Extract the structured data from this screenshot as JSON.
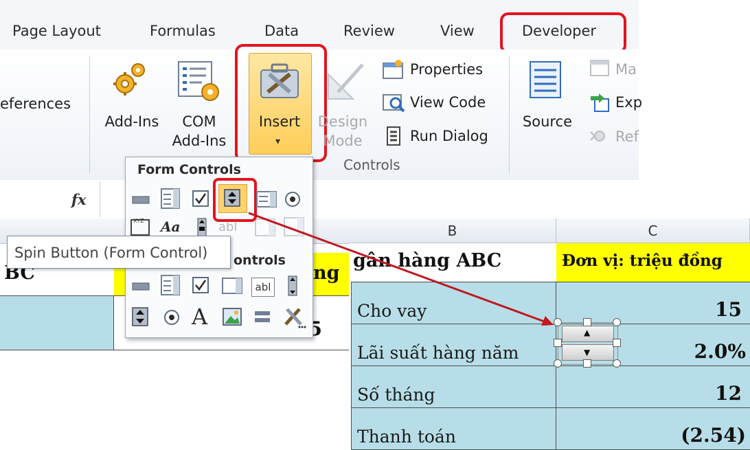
{
  "tabs": [
    {
      "label": "Page Layout"
    },
    {
      "label": "Formulas"
    },
    {
      "label": "Data"
    },
    {
      "label": "Review"
    },
    {
      "label": "View"
    },
    {
      "label": "Developer"
    }
  ],
  "ribbon": {
    "references_partial": "eferences",
    "addins_label": "Add-Ins",
    "com_line1": "COM",
    "com_line2": "Add-Ins",
    "insert_label": "Insert",
    "design_line1": "Design",
    "design_line2": "Mode",
    "properties_label": "Properties",
    "view_code_label": "View Code",
    "run_dialog_label": "Run Dialog",
    "controls_group_label": "Controls",
    "source_label": "Source",
    "map_partial": "Ma",
    "exp_partial": "Exp",
    "ref_partial": "Ref"
  },
  "formula_bar": {
    "fx_label": "fx"
  },
  "popup": {
    "form_controls_title": "Form Controls",
    "activex_title_partial": "ontrols"
  },
  "tooltip": {
    "text": "Spin Button (Form Control)"
  },
  "background_sheet": {
    "title_partial": "BC",
    "ng_partial": "ng",
    "value_partial": "15"
  },
  "sheet": {
    "col_b": "B",
    "col_c": "C",
    "title": "gân hàng ABC",
    "unit": "Đơn vị: triệu đồng",
    "rows": [
      {
        "label": "Cho vay",
        "value": "15"
      },
      {
        "label": "Lãi suất hàng năm",
        "value": "2.0%"
      },
      {
        "label": "Số tháng",
        "value": "12"
      },
      {
        "label": "Thanh toán",
        "value": "(2.54)"
      }
    ]
  },
  "colors": {
    "highlight_red": "#e0141e",
    "cell_blue": "#b7dee8",
    "cell_yellow": "#ffff00",
    "insert_orange": "#ffd36b"
  }
}
